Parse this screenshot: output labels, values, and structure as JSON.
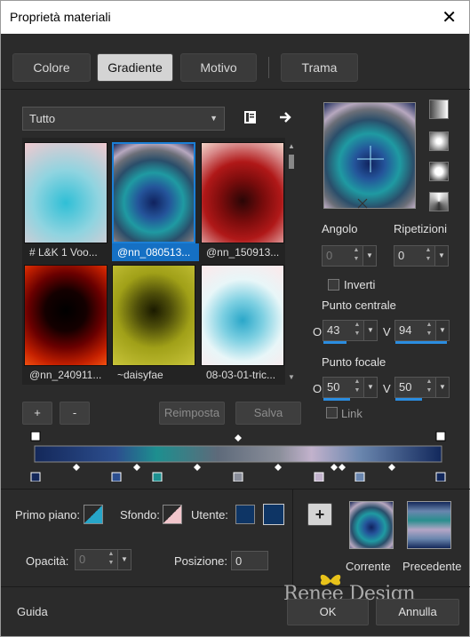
{
  "window": {
    "title": "Proprietà materiali",
    "close_label": "✕"
  },
  "tabs": [
    {
      "label": "Colore",
      "active": false
    },
    {
      "label": "Gradiente",
      "active": true
    },
    {
      "label": "Motivo",
      "active": false
    },
    {
      "label": "Trama",
      "active": false
    }
  ],
  "library": {
    "dropdown_value": "Tutto",
    "presets": [
      {
        "label": "# L&K 1 Voo...",
        "selected": false
      },
      {
        "label": "@nn_080513...",
        "selected": true
      },
      {
        "label": "@nn_150913...",
        "selected": false
      },
      {
        "label": "@nn_240911...",
        "selected": false
      },
      {
        "label": "~daisyfae",
        "selected": false
      },
      {
        "label": "08-03-01-tric...",
        "selected": false
      }
    ],
    "add_label": "+",
    "remove_label": "-",
    "reset_label": "Reimposta",
    "save_label": "Salva"
  },
  "gradient": {
    "angle_label": "Angolo",
    "angle_value": "0",
    "repeats_label": "Ripetizioni",
    "repeats_value": "0",
    "invert_label": "Inverti",
    "center_label": "Punto centrale",
    "center_h_label": "O",
    "center_h_value": "43",
    "center_v_label": "V",
    "center_v_value": "94",
    "focal_label": "Punto focale",
    "focal_h_label": "O",
    "focal_h_value": "50",
    "focal_v_label": "V",
    "focal_v_value": "50",
    "link_label": "Link"
  },
  "colors": {
    "foreground_label": "Primo piano:",
    "background_label": "Sfondo:",
    "user_label": "Utente:",
    "user_color": "#0e3565",
    "opacity_label": "Opacità:",
    "opacity_value": "0",
    "position_label": "Posizione:",
    "position_value": "0"
  },
  "preview": {
    "add_label": "+",
    "current_label": "Corrente",
    "previous_label": "Precedente"
  },
  "footer": {
    "help_label": "Guida",
    "watermark": "Renee Design",
    "ok_label": "OK",
    "cancel_label": "Annulla"
  }
}
